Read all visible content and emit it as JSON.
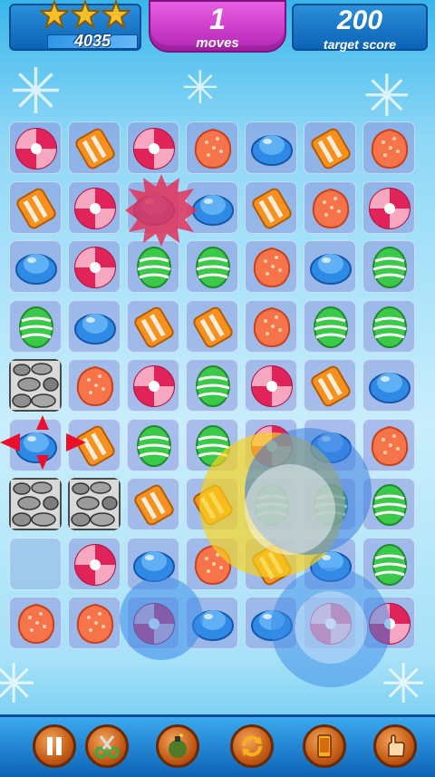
{
  "hud": {
    "stars_earned": 3,
    "score": "4035",
    "score_progress": 1.0,
    "moves": "1",
    "moves_label": "moves",
    "target_score": "200",
    "target_label": "target score"
  },
  "board": {
    "rows": 9,
    "cols": 7,
    "grid": [
      [
        "swirl",
        "wrapped",
        "swirl",
        "gummy",
        "lolli",
        "wrapped",
        "gummy"
      ],
      [
        "wrapped",
        "swirl",
        "lolli",
        "lolli",
        "wrapped",
        "gummy",
        "swirl"
      ],
      [
        "lolli",
        "swirl",
        "egg",
        "egg",
        "gummy",
        "lolli",
        "egg"
      ],
      [
        "egg",
        "lolli",
        "wrapped",
        "wrapped",
        "gummy",
        "egg",
        "egg"
      ],
      [
        "stone",
        "gummy",
        "swirl",
        "egg",
        "swirl",
        "wrapped",
        "lolli"
      ],
      [
        "lolli",
        "wrapped",
        "egg",
        "egg",
        "swirl",
        "lolli",
        "gummy"
      ],
      [
        "stone",
        "stone",
        "wrapped",
        "wrapped",
        "egg",
        "egg",
        "egg"
      ],
      [
        "empty",
        "swirl",
        "lolli",
        "gummy",
        "wrapped",
        "lolli",
        "egg"
      ],
      [
        "gummy",
        "gummy",
        "swirl",
        "lolli",
        "lolli",
        "swirl",
        "swirl"
      ]
    ]
  },
  "toolbar": {
    "buttons": [
      {
        "name": "pause-button",
        "icon": "pause-icon"
      },
      {
        "name": "scissors-button",
        "icon": "scissors-icon"
      },
      {
        "name": "bomb-button",
        "icon": "bomb-icon"
      },
      {
        "name": "shuffle-button",
        "icon": "shuffle-icon"
      },
      {
        "name": "phone-button",
        "icon": "phone-icon"
      },
      {
        "name": "hand-button",
        "icon": "hand-icon"
      }
    ]
  },
  "colors": {
    "candy_orange": "#f6901e",
    "candy_red": "#e0245a",
    "candy_blue": "#2f8ae6",
    "candy_green": "#3bc94a",
    "panel_blue": "#0d63b6",
    "panel_pink": "#c535c6"
  }
}
